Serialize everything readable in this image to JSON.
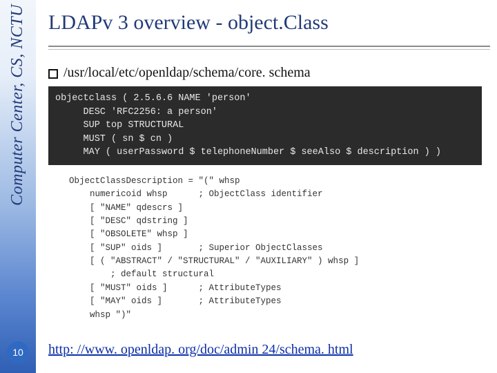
{
  "sidebar": {
    "org_label": "Computer Center, CS, NCTU",
    "page_number": "10"
  },
  "title": "LDAPv 3 overview - object.Class",
  "bullet": {
    "text": "/usr/local/etc/openldap/schema/core. schema"
  },
  "code_dark": "objectclass ( 2.5.6.6 NAME 'person'\n     DESC 'RFC2256: a person'\n     SUP top STRUCTURAL\n     MUST ( sn $ cn )\n     MAY ( userPassword $ telephoneNumber $ seeAlso $ description ) )",
  "code_light": "ObjectClassDescription = \"(\" whsp\n    numericoid whsp      ; ObjectClass identifier\n    [ \"NAME\" qdescrs ]\n    [ \"DESC\" qdstring ]\n    [ \"OBSOLETE\" whsp ]\n    [ \"SUP\" oids ]       ; Superior ObjectClasses\n    [ ( \"ABSTRACT\" / \"STRUCTURAL\" / \"AUXILIARY\" ) whsp ]\n        ; default structural\n    [ \"MUST\" oids ]      ; AttributeTypes\n    [ \"MAY\" oids ]       ; AttributeTypes\n    whsp \")\"",
  "footer": {
    "link_text": "http: //www. openldap. org/doc/admin 24/schema. html"
  }
}
